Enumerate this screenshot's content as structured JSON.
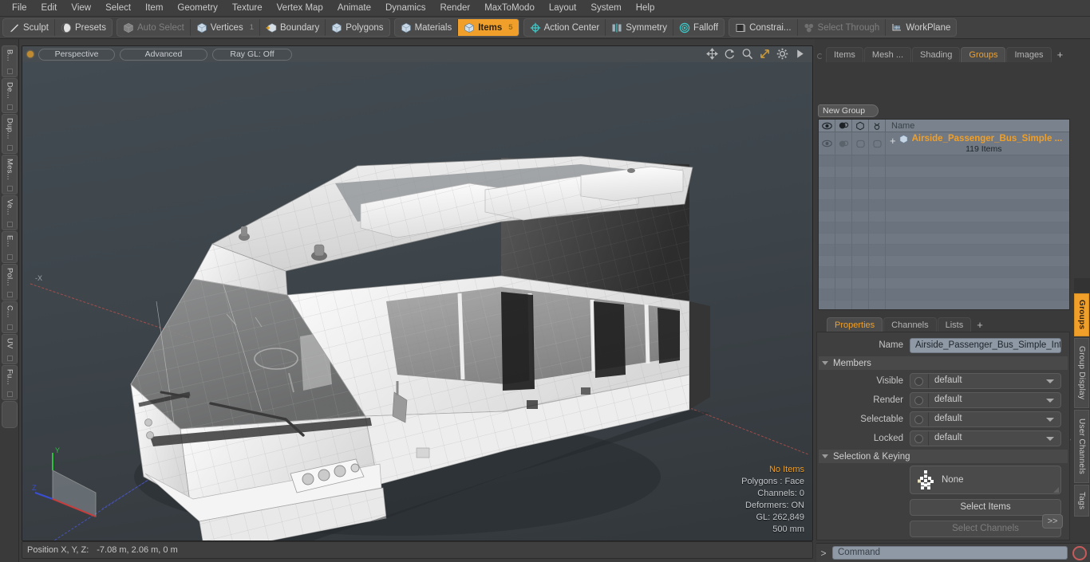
{
  "menu": {
    "items": [
      "File",
      "Edit",
      "View",
      "Select",
      "Item",
      "Geometry",
      "Texture",
      "Vertex Map",
      "Animate",
      "Dynamics",
      "Render",
      "MaxToModo",
      "Layout",
      "System",
      "Help"
    ]
  },
  "toolbar": {
    "group1": [
      {
        "label": "Sculpt",
        "icon": "pencil-icon",
        "state": "normal",
        "num": ""
      },
      {
        "label": "Presets",
        "icon": "sphere-icon",
        "state": "normal",
        "num": ""
      }
    ],
    "group2": [
      {
        "label": "Auto Select",
        "icon": "cube-icon",
        "state": "dim",
        "num": ""
      },
      {
        "label": "Vertices",
        "icon": "cube-icon",
        "state": "normal",
        "num": "1"
      },
      {
        "label": "Boundary",
        "icon": "cube-arrow-icon",
        "state": "normal",
        "num": ""
      },
      {
        "label": "Polygons",
        "icon": "cube-icon",
        "state": "normal",
        "num": ""
      }
    ],
    "group3": [
      {
        "label": "Materials",
        "icon": "cube-icon",
        "state": "normal",
        "num": ""
      },
      {
        "label": "Items",
        "icon": "cube-icon",
        "state": "active",
        "num": "5"
      }
    ],
    "group4": [
      {
        "label": "Action Center",
        "icon": "action-center-icon",
        "state": "normal",
        "num": ""
      },
      {
        "label": "Symmetry",
        "icon": "symmetry-icon",
        "state": "normal",
        "num": ""
      },
      {
        "label": "Falloff",
        "icon": "falloff-icon",
        "state": "normal",
        "num": ""
      }
    ],
    "group5": [
      {
        "label": "Constrai...",
        "icon": "constraint-icon",
        "state": "normal",
        "num": ""
      },
      {
        "label": "Select Through",
        "icon": "select-through-icon",
        "state": "dim",
        "num": ""
      },
      {
        "label": "WorkPlane",
        "icon": "workplane-icon",
        "state": "normal",
        "num": ""
      }
    ]
  },
  "left_rail": {
    "tabs": [
      "B...",
      "De...",
      "Dup...",
      "Mes...",
      "Ve...",
      "E...",
      "Pol...",
      "C...",
      "UV",
      "Fu..."
    ]
  },
  "viewport": {
    "header": {
      "view_mode": "Perspective",
      "shading": "Advanced",
      "raygl": "Ray GL: Off"
    },
    "tools": [
      "move-icon",
      "rotate-icon",
      "magnify-icon",
      "fit-icon",
      "gear-icon",
      "play-icon"
    ],
    "axis_labels": {
      "x": "-X",
      "y": "Y",
      "z": "Z"
    },
    "stats": {
      "selection": "No Items",
      "polygons": "Polygons : Face",
      "channels": "Channels: 0",
      "deformers": "Deformers: ON",
      "gl": "GL: 262,849",
      "grid": "500 mm"
    },
    "background_color": "#3e464c",
    "model_name": "Airside Passenger Bus"
  },
  "statusbar": {
    "label": "Position X, Y, Z:",
    "value": "-7.08 m, 2.06 m, 0 m"
  },
  "right_panel": {
    "top_tabs": [
      {
        "label": "Items",
        "selected": false
      },
      {
        "label": "Mesh ...",
        "selected": false
      },
      {
        "label": "Shading",
        "selected": false
      },
      {
        "label": "Groups",
        "selected": true
      },
      {
        "label": "Images",
        "selected": false
      }
    ],
    "add_tab_label": "+",
    "new_group_button": "New Group",
    "group_list": {
      "columns": [
        "eye-icon",
        "render-icon",
        "shape-icon",
        "lock-icon"
      ],
      "name_header": "Name",
      "rows": [
        {
          "name": "Airside_Passenger_Bus_Simple  ...",
          "sub": "119 Items",
          "expand": "+"
        }
      ]
    },
    "prop_tabs": [
      {
        "label": "Properties",
        "selected": true
      },
      {
        "label": "Channels",
        "selected": false
      },
      {
        "label": "Lists",
        "selected": false
      }
    ],
    "prop_add_tab": "+",
    "properties": {
      "name_label": "Name",
      "name_value": "Airside_Passenger_Bus_Simple_Interio",
      "members_section": "Members",
      "members": [
        {
          "label": "Visible",
          "value": "default"
        },
        {
          "label": "Render",
          "value": "default"
        },
        {
          "label": "Selectable",
          "value": "default"
        },
        {
          "label": "Locked",
          "value": "default"
        }
      ],
      "selection_section": "Selection & Keying",
      "selection_set": "None",
      "select_items_button": "Select Items",
      "select_channels_button": "Select Channels",
      "more_button": ">>"
    },
    "command_bar": {
      "prompt": ">",
      "placeholder": "Command",
      "record_icon": "record-icon"
    },
    "side_tabs": [
      {
        "label": "Groups",
        "selected": true
      },
      {
        "label": "Group Display",
        "selected": false
      },
      {
        "label": "User Channels",
        "selected": false
      },
      {
        "label": "Tags",
        "selected": false
      }
    ]
  },
  "colors": {
    "accent": "#f0a02a",
    "panel": "#3f3f3f",
    "field": "#8e99a5"
  }
}
